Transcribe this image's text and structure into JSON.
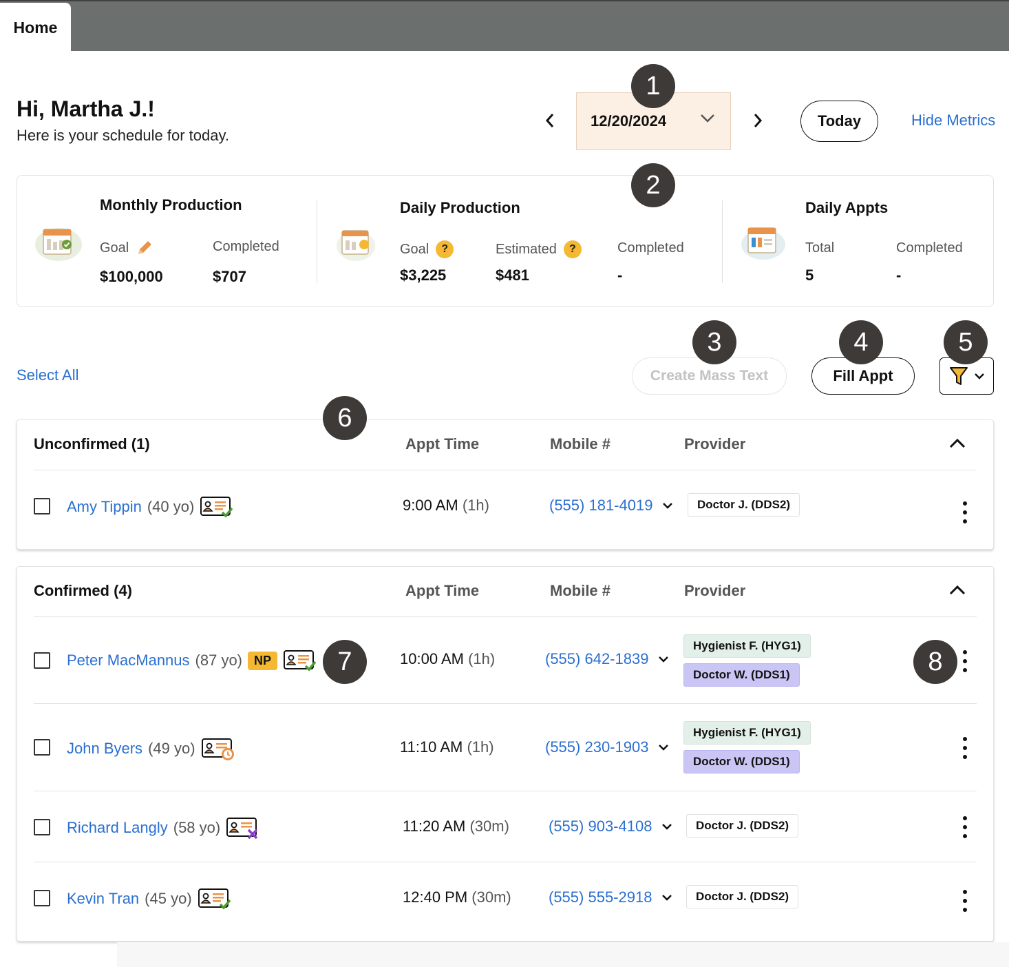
{
  "tabs": [
    {
      "label": "Home"
    }
  ],
  "greeting": {
    "title": "Hi, Martha J.!",
    "subtitle": "Here is your schedule for today."
  },
  "date_nav": {
    "date": "12/20/2024",
    "today_label": "Today",
    "hide_metrics_label": "Hide Metrics"
  },
  "metrics": {
    "monthly": {
      "title": "Monthly Production",
      "goal_label": "Goal",
      "goal_value": "$100,000",
      "completed_label": "Completed",
      "completed_value": "$707"
    },
    "daily_production": {
      "title": "Daily Production",
      "goal_label": "Goal",
      "goal_value": "$3,225",
      "estimated_label": "Estimated",
      "estimated_value": "$481",
      "completed_label": "Completed",
      "completed_value": "-",
      "help": "?"
    },
    "daily_appts": {
      "title": "Daily Appts",
      "total_label": "Total",
      "total_value": "5",
      "completed_label": "Completed",
      "completed_value": "-"
    }
  },
  "actions": {
    "select_all": "Select All",
    "mass_text": "Create Mass Text",
    "fill_appt": "Fill Appt"
  },
  "columns": {
    "appt_time": "Appt Time",
    "mobile": "Mobile #",
    "provider": "Provider"
  },
  "groups": [
    {
      "title": "Unconfirmed (1)",
      "rows": [
        {
          "name": "Amy Tippin",
          "age": "(40 yo)",
          "time": "9:00 AM",
          "dur": "(1h)",
          "phone": "(555) 181-4019",
          "providers": [
            "Doctor J. (DDS2)"
          ],
          "form_status": "check-icon"
        }
      ]
    },
    {
      "title": "Confirmed (4)",
      "rows": [
        {
          "name": "Peter MacMannus",
          "age": "(87 yo)",
          "np": "NP",
          "time": "10:00 AM",
          "dur": "(1h)",
          "phone": "(555) 642-1839",
          "providers": [
            "Hygienist F. (HYG1)",
            "Doctor W. (DDS1)"
          ],
          "form_status": "check-icon"
        },
        {
          "name": "John Byers",
          "age": "(49 yo)",
          "time": "11:10 AM",
          "dur": "(1h)",
          "phone": "(555) 230-1903",
          "providers": [
            "Hygienist F. (HYG1)",
            "Doctor W. (DDS1)"
          ],
          "form_status": "pending-icon"
        },
        {
          "name": "Richard Langly",
          "age": "(58 yo)",
          "time": "11:20 AM",
          "dur": "(30m)",
          "phone": "(555) 903-4108",
          "providers": [
            "Doctor J. (DDS2)"
          ],
          "form_status": "x-icon"
        },
        {
          "name": "Kevin Tran",
          "age": "(45 yo)",
          "time": "12:40 PM",
          "dur": "(30m)",
          "phone": "(555) 555-2918",
          "providers": [
            "Doctor J. (DDS2)"
          ],
          "form_status": "check-icon"
        }
      ]
    }
  ],
  "callouts": [
    "1",
    "2",
    "3",
    "4",
    "5",
    "6",
    "7",
    "8"
  ],
  "colors": {
    "link": "#2a6fd1",
    "accent": "#f4b833",
    "date_bg": "#fcefe3",
    "hyg_bg": "#e3f0ea",
    "doc_bg": "#c9c6f5",
    "callout": "#3d3a37"
  }
}
